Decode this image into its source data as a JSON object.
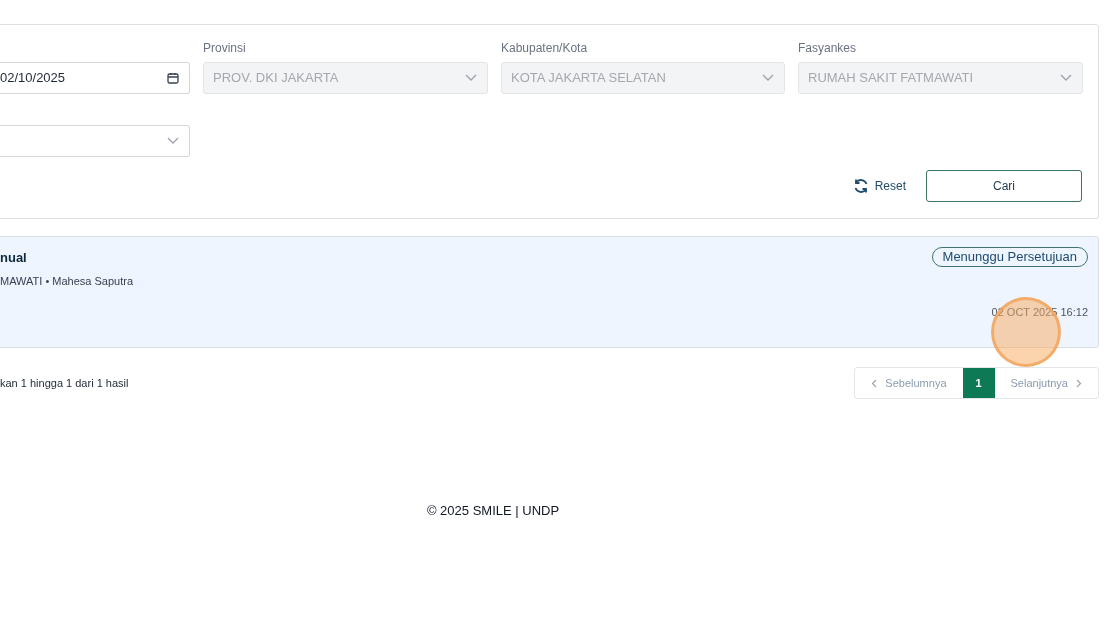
{
  "filters": {
    "fields": [
      {
        "value": "02/10/2025",
        "kind": "date",
        "disabled": false
      },
      {
        "label": "Provinsi",
        "value": "PROV. DKI JAKARTA",
        "kind": "select",
        "disabled": true
      },
      {
        "label": "Kabupaten/Kota",
        "value": "KOTA JAKARTA SELATAN",
        "kind": "select",
        "disabled": true
      },
      {
        "label": "Fasyankes",
        "value": "RUMAH SAKIT FATMAWATI",
        "kind": "select",
        "disabled": true
      },
      {
        "kind": "select",
        "disabled": false
      }
    ],
    "reset_button": "Reset",
    "search_button": "Cari"
  },
  "results": [
    {
      "title": "nual",
      "subtitle": "MAWATI • Mahesa Saputra",
      "status": "Menunggu Persetujuan",
      "timestamp": "02 OCT 2025 16:12"
    }
  ],
  "pagination": {
    "summary": "kan 1 hingga 1 dari 1 hasil",
    "previous": "Sebelumnya",
    "pages": [
      {
        "label": "1",
        "selected": true
      }
    ],
    "next": "Selanjutnya"
  },
  "footer": "© 2025 SMILE | UNDP"
}
